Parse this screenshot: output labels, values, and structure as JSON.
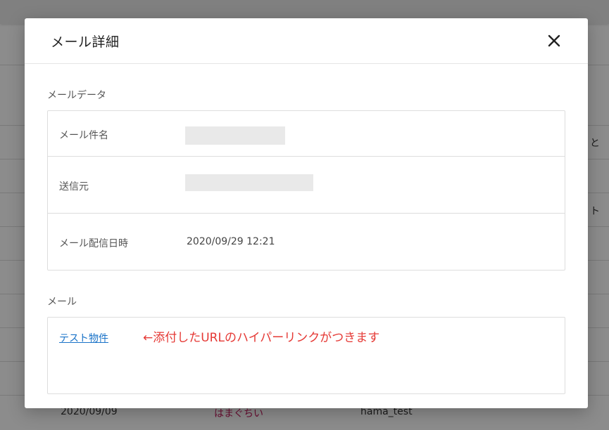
{
  "background": {
    "fragments": [
      "と",
      "ト"
    ],
    "last_row": {
      "date": "2020/09/09",
      "name": "はまぐちい",
      "user": "hama_test"
    }
  },
  "modal": {
    "title": "メール詳細",
    "close_icon": "close-icon",
    "mail_data_section": {
      "label": "メールデータ",
      "rows": [
        {
          "label": "メール件名",
          "value": ""
        },
        {
          "label": "送信元",
          "value": ""
        },
        {
          "label": "メール配信日時",
          "value": "2020/09/29 12:21"
        }
      ]
    },
    "mail_section": {
      "label": "メール",
      "link_text": "テスト物件",
      "annotation": "←添付したURLのハイパーリンクがつきます"
    }
  },
  "colors": {
    "link": "#1a73c8",
    "annotation": "#e53935",
    "overlay": "rgba(0,0,0,0.45)"
  }
}
